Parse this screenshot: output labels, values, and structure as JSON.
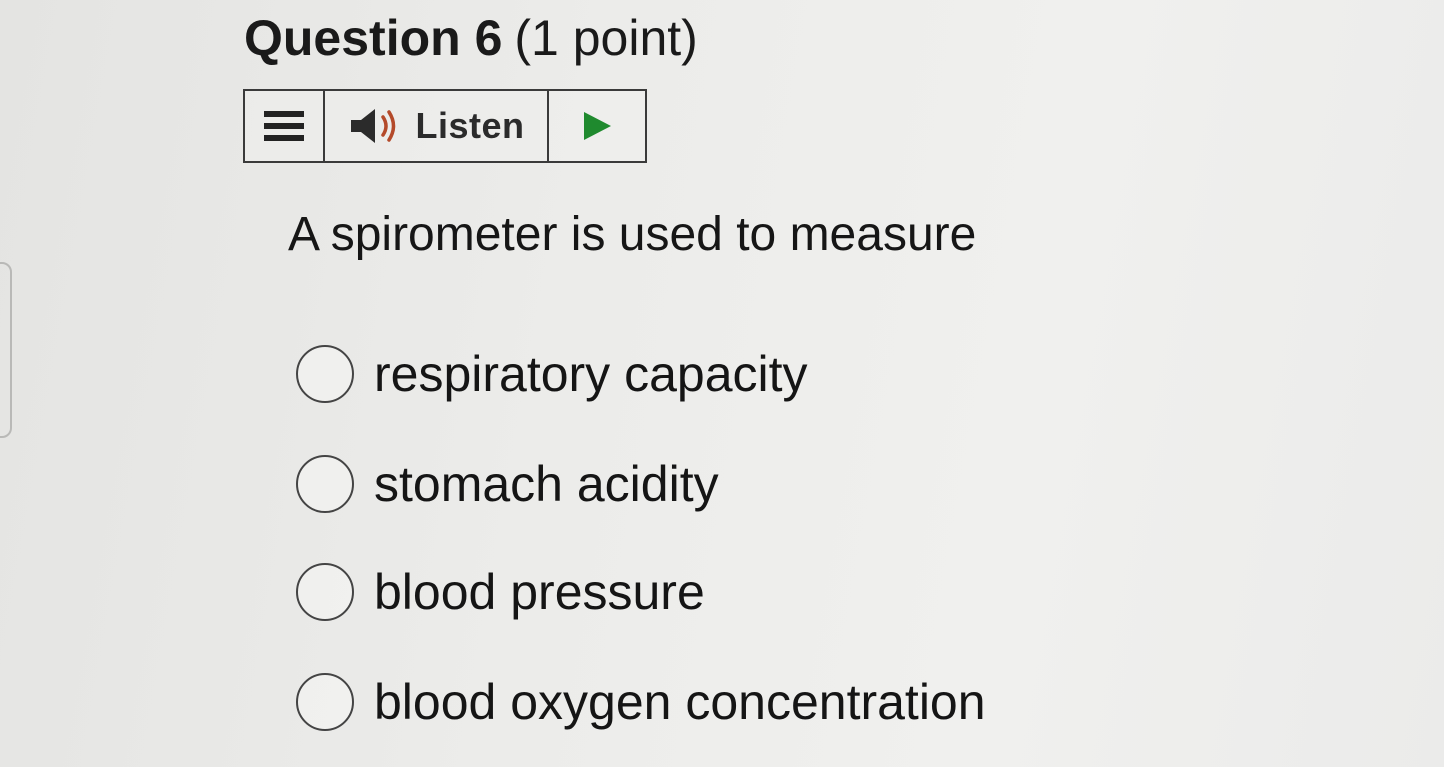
{
  "question": {
    "label": "Question 6",
    "points": "(1 point)",
    "text": "A spirometer is used to measure"
  },
  "toolbar": {
    "listen_label": "Listen",
    "menu_icon": "hamburger-menu-icon",
    "speaker_icon": "speaker-icon",
    "play_icon": "play-icon",
    "play_color": "#1f8a2e"
  },
  "options": [
    {
      "label": "respiratory capacity",
      "selected": false
    },
    {
      "label": "stomach acidity",
      "selected": false
    },
    {
      "label": "blood pressure",
      "selected": false
    },
    {
      "label": "blood oxygen concentration",
      "selected": false
    }
  ]
}
